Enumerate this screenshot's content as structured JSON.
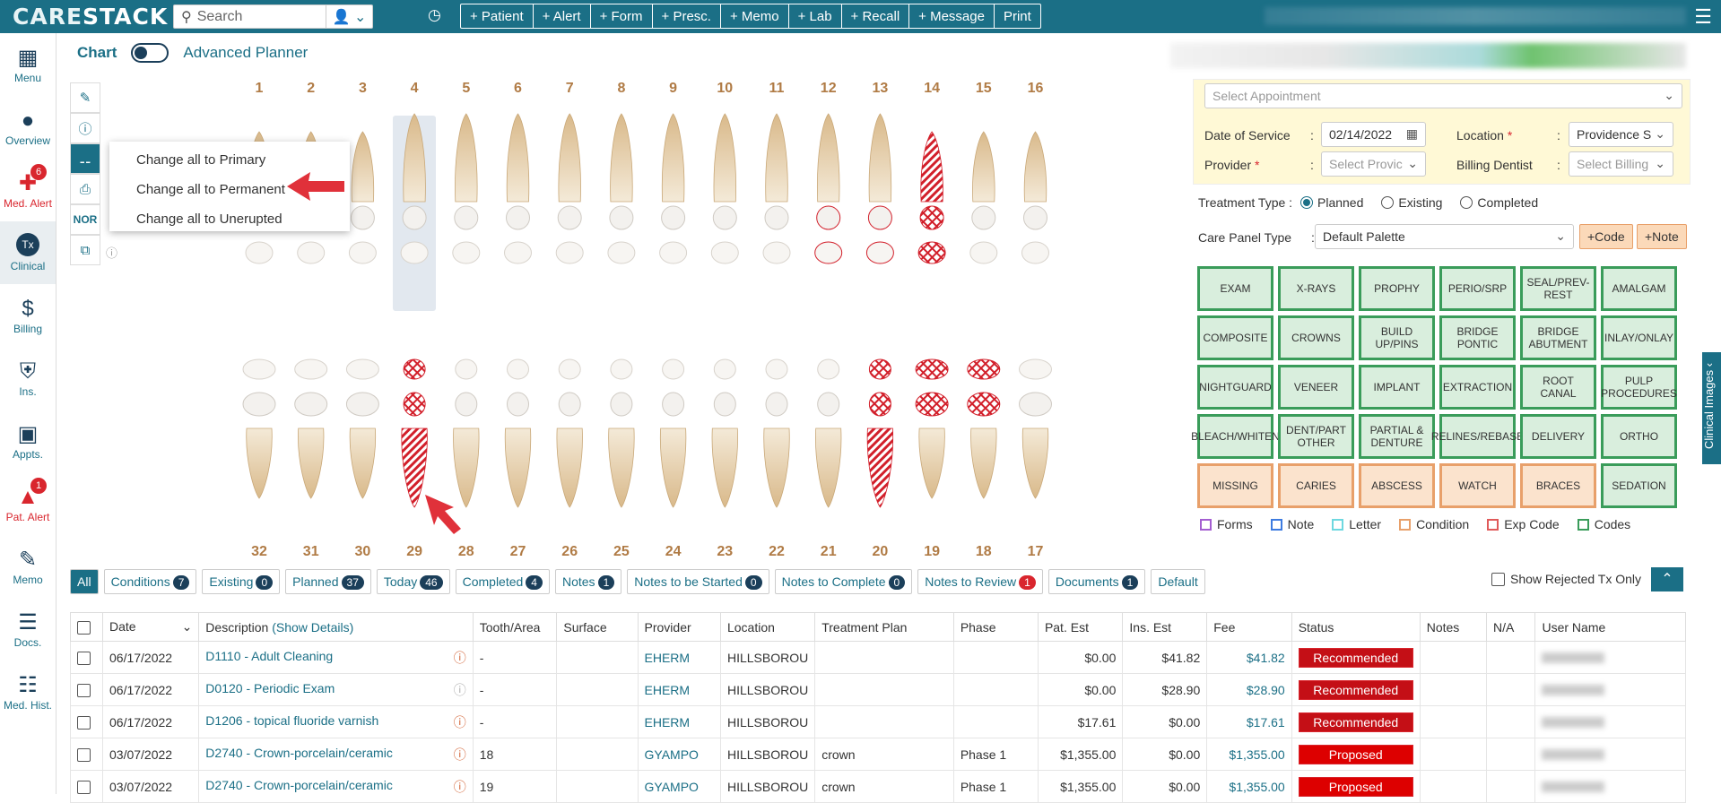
{
  "app": {
    "logo_main": "CARE",
    "logo_accent": "STACK"
  },
  "search": {
    "placeholder": "Search"
  },
  "quick_actions": [
    "+ Patient",
    "+ Alert",
    "+ Form",
    "+ Presc.",
    "+ Memo",
    "+ Lab",
    "+ Recall",
    "+ Message",
    "Print"
  ],
  "sidebar": [
    {
      "label": "Menu",
      "icon": "grid-icon"
    },
    {
      "label": "Overview",
      "icon": "person-icon"
    },
    {
      "label": "Med. Alert",
      "icon": "medical-alert-icon",
      "badge": "6",
      "alert": true
    },
    {
      "label": "Clinical",
      "icon": "tx-icon",
      "active": true
    },
    {
      "label": "Billing",
      "icon": "billing-icon"
    },
    {
      "label": "Ins.",
      "icon": "shield-icon"
    },
    {
      "label": "Appts.",
      "icon": "calendar-icon"
    },
    {
      "label": "Pat. Alert",
      "icon": "patient-alert-icon",
      "badge": "1",
      "alert": true
    },
    {
      "label": "Memo",
      "icon": "memo-icon"
    },
    {
      "label": "Docs.",
      "icon": "docs-icon"
    },
    {
      "label": "Med. Hist.",
      "icon": "med-history-icon"
    }
  ],
  "chart": {
    "title": "Chart",
    "advanced_planner": "Advanced Planner",
    "tool_nor": "NOR"
  },
  "teeth": {
    "upper": [
      "1",
      "2",
      "3",
      "4",
      "5",
      "6",
      "7",
      "8",
      "9",
      "10",
      "11",
      "12",
      "13",
      "14",
      "15",
      "16"
    ],
    "lower": [
      "32",
      "31",
      "30",
      "29",
      "28",
      "27",
      "26",
      "25",
      "24",
      "23",
      "22",
      "21",
      "20",
      "19",
      "18",
      "17"
    ]
  },
  "popup": {
    "items": [
      "Change all to Primary",
      "Change all to Permanent",
      "Change all to Unerupted"
    ]
  },
  "appointment": {
    "select_appointment": "Select Appointment",
    "date_label": "Date of Service",
    "date_value": "02/14/2022",
    "location_label": "Location",
    "location_value": "Providence S",
    "provider_label": "Provider",
    "provider_placeholder": "Select Provic",
    "billing_label": "Billing Dentist",
    "billing_placeholder": "Select Billing"
  },
  "treatment_type": {
    "label": "Treatment Type",
    "options": [
      "Planned",
      "Existing",
      "Completed"
    ],
    "selected": "Planned"
  },
  "care_panel": {
    "label": "Care Panel Type",
    "value": "Default Palette",
    "code_btn": "+Code",
    "note_btn": "+Note"
  },
  "procedure_buttons": [
    {
      "label": "EXAM"
    },
    {
      "label": "X-RAYS"
    },
    {
      "label": "PROPHY"
    },
    {
      "label": "PERIO/SRP"
    },
    {
      "label": "SEAL/PREV-REST"
    },
    {
      "label": "AMALGAM"
    },
    {
      "label": "COMPOSITE"
    },
    {
      "label": "CROWNS"
    },
    {
      "label": "BUILD UP/PINS"
    },
    {
      "label": "BRIDGE PONTIC"
    },
    {
      "label": "BRIDGE ABUTMENT"
    },
    {
      "label": "INLAY/ONLAY"
    },
    {
      "label": "NIGHTGUARD"
    },
    {
      "label": "VENEER"
    },
    {
      "label": "IMPLANT"
    },
    {
      "label": "EXTRACTION"
    },
    {
      "label": "ROOT CANAL"
    },
    {
      "label": "PULP PROCEDURES"
    },
    {
      "label": "BLEACH/WHITEN"
    },
    {
      "label": "DENT/PART OTHER"
    },
    {
      "label": "PARTIAL & DENTURE"
    },
    {
      "label": "RELINES/REBASE"
    },
    {
      "label": "DELIVERY"
    },
    {
      "label": "ORTHO"
    },
    {
      "label": "MISSING",
      "kind": "condition"
    },
    {
      "label": "CARIES",
      "kind": "condition"
    },
    {
      "label": "ABSCESS",
      "kind": "condition"
    },
    {
      "label": "WATCH",
      "kind": "condition"
    },
    {
      "label": "BRACES",
      "kind": "condition"
    },
    {
      "label": "SEDATION",
      "kind": "code"
    }
  ],
  "legend": [
    {
      "label": "Forms",
      "color": "#a45ed1"
    },
    {
      "label": "Note",
      "color": "#3d7be0"
    },
    {
      "label": "Letter",
      "color": "#6ed8e0"
    },
    {
      "label": "Condition",
      "color": "#e8a06a"
    },
    {
      "label": "Exp Code",
      "color": "#e05a5a"
    },
    {
      "label": "Codes",
      "color": "#3a9c5a"
    }
  ],
  "clinical_images_tab": "Clinical Images",
  "filters": [
    {
      "label": "All"
    },
    {
      "label": "Conditions",
      "count": "7"
    },
    {
      "label": "Existing",
      "count": "0"
    },
    {
      "label": "Planned",
      "count": "37"
    },
    {
      "label": "Today",
      "count": "46"
    },
    {
      "label": "Completed",
      "count": "4"
    },
    {
      "label": "Notes",
      "count": "1"
    },
    {
      "label": "Notes to be Started",
      "count": "0"
    },
    {
      "label": "Notes to Complete",
      "count": "0"
    },
    {
      "label": "Notes to Review",
      "count": "1",
      "red": true
    },
    {
      "label": "Documents",
      "count": "1"
    },
    {
      "label": "Default"
    }
  ],
  "show_rejected": "Show Rejected Tx Only",
  "table": {
    "headers": [
      "Date",
      "Description",
      "Tooth/Area",
      "Surface",
      "Provider",
      "Location",
      "Treatment Plan",
      "Phase",
      "Pat. Est",
      "Ins. Est",
      "Fee",
      "Status",
      "Notes",
      "N/A",
      "User Name"
    ],
    "show_details": "(Show Details)",
    "rows": [
      {
        "date": "06/17/2022",
        "desc": "D1110 - Adult Cleaning",
        "tooth": "-",
        "surface": "",
        "provider": "EHERM",
        "location": "HILLSBOROU",
        "plan": "",
        "phase": "",
        "pat": "$0.00",
        "ins": "$41.82",
        "fee": "$41.82",
        "status": "Recommended"
      },
      {
        "date": "06/17/2022",
        "desc": "D0120 - Periodic Exam",
        "tooth": "-",
        "surface": "",
        "provider": "EHERM",
        "location": "HILLSBOROU",
        "plan": "",
        "phase": "",
        "pat": "$0.00",
        "ins": "$28.90",
        "fee": "$28.90",
        "status": "Recommended"
      },
      {
        "date": "06/17/2022",
        "desc": "D1206 - topical fluoride varnish",
        "tooth": "-",
        "surface": "",
        "provider": "EHERM",
        "location": "HILLSBOROU",
        "plan": "",
        "phase": "",
        "pat": "$17.61",
        "ins": "$0.00",
        "fee": "$17.61",
        "status": "Recommended"
      },
      {
        "date": "03/07/2022",
        "desc": "D2740 - Crown-porcelain/ceramic",
        "tooth": "18",
        "surface": "",
        "provider": "GYAMPO",
        "location": "HILLSBOROU",
        "plan": "crown",
        "phase": "Phase 1",
        "pat": "$1,355.00",
        "ins": "$0.00",
        "fee": "$1,355.00",
        "status": "Proposed"
      },
      {
        "date": "03/07/2022",
        "desc": "D2740 - Crown-porcelain/ceramic",
        "tooth": "19",
        "surface": "",
        "provider": "GYAMPO",
        "location": "HILLSBOROU",
        "plan": "crown",
        "phase": "Phase 1",
        "pat": "$1,355.00",
        "ins": "$0.00",
        "fee": "$1,355.00",
        "status": "Proposed"
      }
    ]
  }
}
